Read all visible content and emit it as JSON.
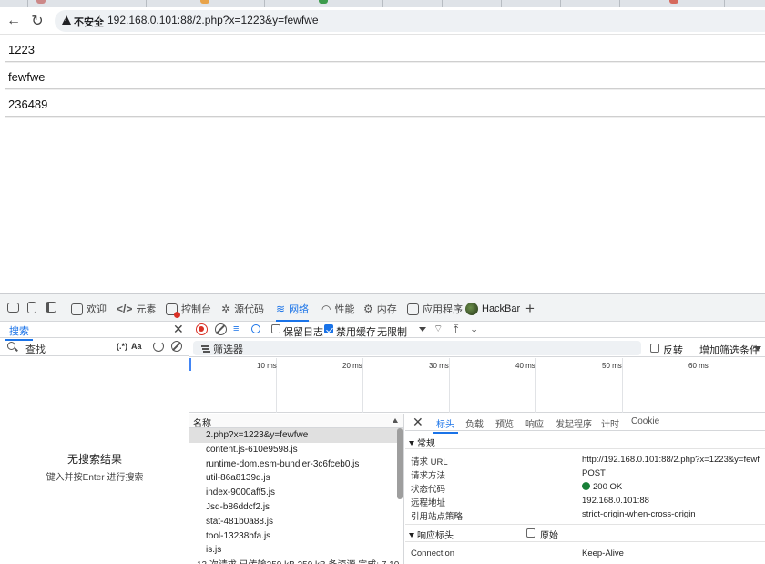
{
  "browser": {
    "insecure_label": "不安全",
    "url": "192.168.0.101:88/2.php?x=1223&y=fewfwe"
  },
  "page": {
    "lines": [
      "1223",
      "fewfwe",
      "236489"
    ]
  },
  "devtools": {
    "tabs": [
      {
        "label": "欢迎",
        "icon": "home-icon"
      },
      {
        "label": "元素",
        "icon": "code-icon"
      },
      {
        "label": "控制台",
        "icon": "console-icon"
      },
      {
        "label": "源代码",
        "icon": "bug-icon"
      },
      {
        "label": "网络",
        "icon": "wifi-icon"
      },
      {
        "label": "性能",
        "icon": "gauge-icon"
      },
      {
        "label": "内存",
        "icon": "gear-icon"
      },
      {
        "label": "应用程序",
        "icon": "app-icon"
      },
      {
        "label": "HackBar",
        "icon": "hackbar-icon"
      }
    ],
    "active_tab": "网络",
    "search": {
      "tab_label": "搜索",
      "placeholder": "查找",
      "regex_label": "(.*)",
      "case_label": "Aa",
      "no_results": "无搜索结果",
      "hint": "键入并按Enter 进行搜索"
    },
    "network": {
      "preserve_log": "保留日志",
      "disable_cache": "禁用缓存",
      "disable_cache_checked": true,
      "preserve_log_checked": false,
      "throttling": "无限制",
      "filter_placeholder": "筛选器",
      "invert": "反转",
      "more_filters": "增加筛选条件",
      "timeline_ticks": [
        "10 ms",
        "20 ms",
        "30 ms",
        "40 ms",
        "50 ms",
        "60 ms"
      ],
      "name_header": "名称",
      "requests": [
        "2.php?x=1223&y=fewfwe",
        "content.js-610e9598.js",
        "runtime-dom.esm-bundler-3c6fceb0.js",
        "util-86a8139d.js",
        "index-9000aff5.js",
        "Jsq-b86ddcf2.js",
        "stat-481b0a88.js",
        "tool-13238bfa.js",
        "is.js"
      ],
      "selected_index": 0,
      "summary": "13 次请求   已传输259 kB   259 kB 条资源   完成: 7.10"
    },
    "details": {
      "tabs": [
        "标头",
        "负载",
        "预览",
        "响应",
        "发起程序",
        "计时",
        "Cookie"
      ],
      "active": "标头",
      "general_title": "常规",
      "general": [
        {
          "k": "请求 URL",
          "v": "http://192.168.0.101:88/2.php?x=1223&y=fewf"
        },
        {
          "k": "请求方法",
          "v": "POST"
        },
        {
          "k": "状态代码",
          "v": "200 OK"
        },
        {
          "k": "远程地址",
          "v": "192.168.0.101:88"
        },
        {
          "k": "引用站点策略",
          "v": "strict-origin-when-cross-origin"
        }
      ],
      "response_title": "响应标头",
      "raw_label": "原始",
      "response": [
        {
          "k": "Connection",
          "v": "Keep-Alive"
        }
      ]
    }
  }
}
